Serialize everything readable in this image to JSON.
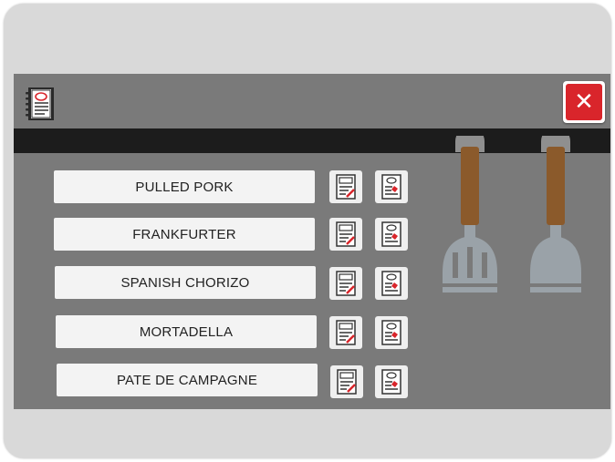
{
  "window": {
    "close_label": "✕"
  },
  "recipes": [
    {
      "label": "PULLED PORK"
    },
    {
      "label": "FRANKFURTER"
    },
    {
      "label": "SPANISH CHORIZO"
    },
    {
      "label": "MORTADELLA"
    },
    {
      "label": "PATE DE CAMPAGNE"
    }
  ],
  "icons": {
    "header": "recipe-book-icon",
    "edit": "edit-document-icon",
    "select": "select-recipe-icon",
    "close": "close-icon",
    "tools": [
      "slotted-spatula-icon",
      "spatula-icon"
    ]
  },
  "colors": {
    "background": "#d9d9d9",
    "panel": "#7a7a7a",
    "rail": "#1c1c1c",
    "close": "#d9252b",
    "handle": "#8b5a2b",
    "tool": "#9aa2a8"
  }
}
